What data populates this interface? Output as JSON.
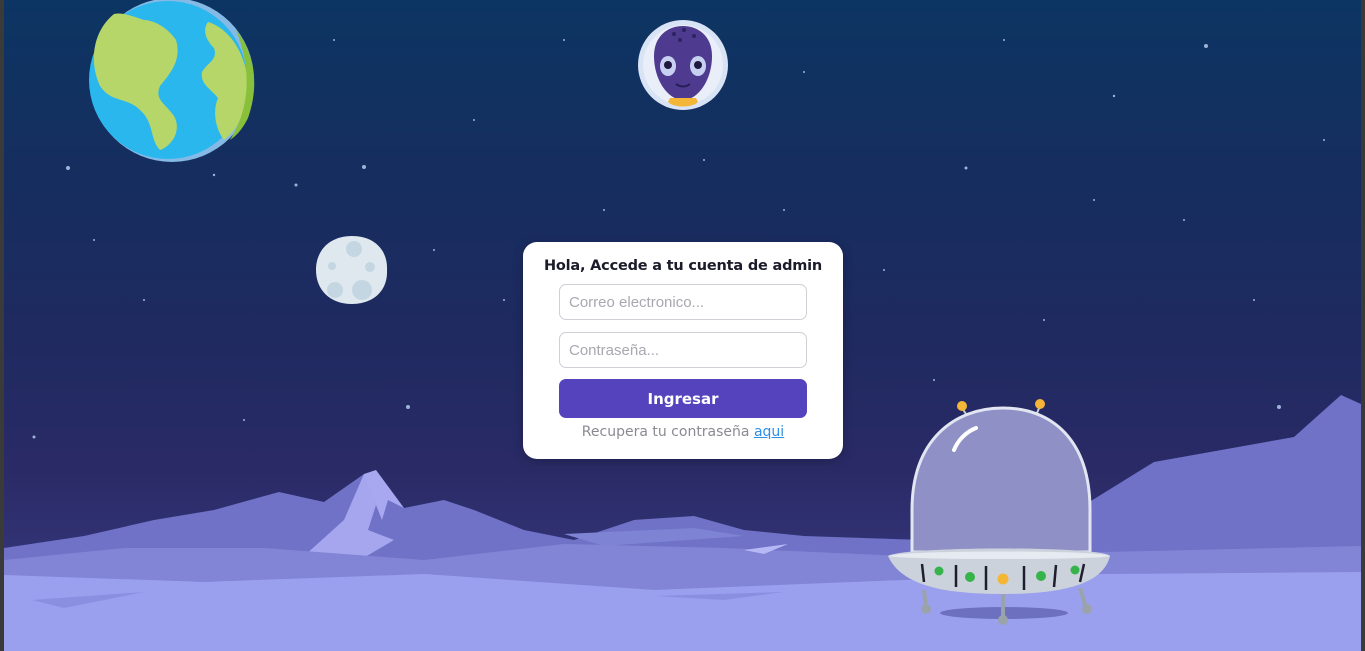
{
  "login": {
    "title": "Hola, Accede a tu cuenta de admin",
    "email_placeholder": "Correo electronico...",
    "password_placeholder": "Contraseña...",
    "submit_label": "Ingresar",
    "recover_text": "Recupera tu contraseña",
    "recover_link": "aqui"
  },
  "theme": {
    "button_color": "#5443bd",
    "link_color": "#2f8fe6",
    "sky_top": "#0c3563",
    "sky_bottom": "#2a2a66",
    "ground": "#9aa0ee"
  },
  "illustrations": [
    "earth-planet",
    "moon",
    "alien-astronaut-avatar",
    "ufo-spaceship",
    "mountain-range",
    "stars"
  ]
}
